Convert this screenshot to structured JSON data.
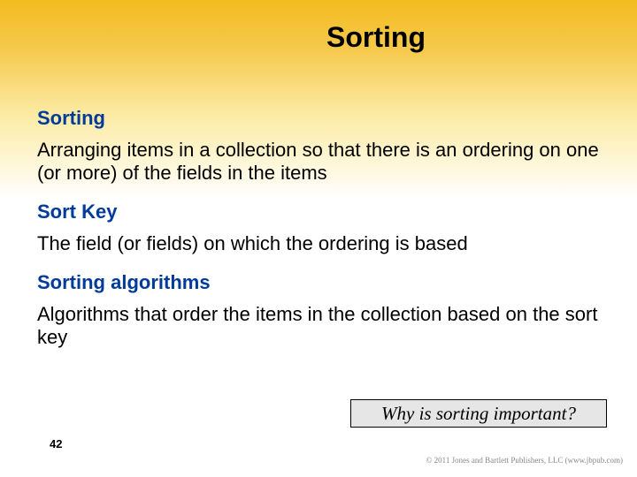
{
  "slide": {
    "title": "Sorting",
    "sections": [
      {
        "term": "Sorting",
        "def": "Arranging items in a collection so that there is an ordering on one (or more) of the fields in the items"
      },
      {
        "term": "Sort Key",
        "def": "The field (or fields) on which the ordering is based"
      },
      {
        "term": "Sorting algorithms",
        "def": "Algorithms that order the items in the collection based on the sort key"
      }
    ],
    "callout": "Why is sorting important?",
    "page_number": "42",
    "copyright": "© 2011 Jones and Bartlett Publishers, LLC (www.jbpub.com)"
  }
}
